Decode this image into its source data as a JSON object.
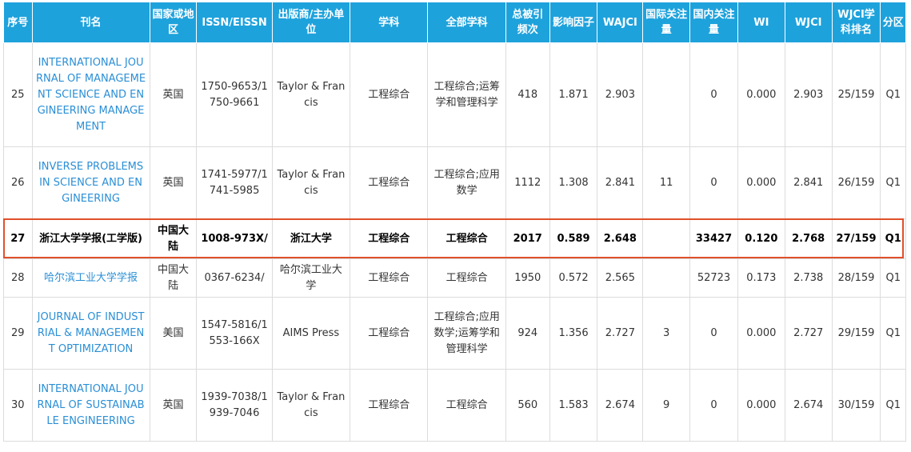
{
  "headers": [
    "序号",
    "刊名",
    "国家或地区",
    "ISSN/EISSN",
    "出版商/主办单位",
    "学科",
    "全部学科",
    "总被引频次",
    "影响因子",
    "WAJCI",
    "国际关注量",
    "国内关注量",
    "WI",
    "WJCI",
    "WJCI学科排名",
    "分区"
  ],
  "rows": [
    {
      "no": "25",
      "name": "INTERNATIONAL JOURNAL OF MANAGEMENT SCIENCE AND ENGINEERING MANAGEMENT",
      "country": "英国",
      "issn": "1750-9653/1750-9661",
      "publisher": "Taylor & Francis",
      "subject": "工程综合",
      "all_subjects": "工程综合;运筹学和管理科学",
      "citations": "418",
      "impact_factor": "1.871",
      "wajci": "2.903",
      "intl_attention": "",
      "domestic_attention": "0",
      "wi": "0.000",
      "wjci": "2.903",
      "rank": "25/159",
      "zone": "Q1"
    },
    {
      "no": "26",
      "name": "INVERSE PROBLEMS IN SCIENCE AND ENGINEERING",
      "country": "英国",
      "issn": "1741-5977/1741-5985",
      "publisher": "Taylor & Francis",
      "subject": "工程综合",
      "all_subjects": "工程综合;应用数学",
      "citations": "1112",
      "impact_factor": "1.308",
      "wajci": "2.841",
      "intl_attention": "11",
      "domestic_attention": "0",
      "wi": "0.000",
      "wjci": "2.841",
      "rank": "26/159",
      "zone": "Q1"
    },
    {
      "no": "27",
      "name": "浙江大学学报(工学版)",
      "country": "中国大陆",
      "issn": "1008-973X/",
      "publisher": "浙江大学",
      "subject": "工程综合",
      "all_subjects": "工程综合",
      "citations": "2017",
      "impact_factor": "0.589",
      "wajci": "2.648",
      "intl_attention": "",
      "domestic_attention": "33427",
      "wi": "0.120",
      "wjci": "2.768",
      "rank": "27/159",
      "zone": "Q1"
    },
    {
      "no": "28",
      "name": "哈尔滨工业大学学报",
      "country": "中国大陆",
      "issn": "0367-6234/",
      "publisher": "哈尔滨工业大学",
      "subject": "工程综合",
      "all_subjects": "工程综合",
      "citations": "1950",
      "impact_factor": "0.572",
      "wajci": "2.565",
      "intl_attention": "",
      "domestic_attention": "52723",
      "wi": "0.173",
      "wjci": "2.738",
      "rank": "28/159",
      "zone": "Q1"
    },
    {
      "no": "29",
      "name": "JOURNAL OF INDUSTRIAL & MANAGEMENT OPTIMIZATION",
      "country": "美国",
      "issn": "1547-5816/1553-166X",
      "publisher": "AIMS Press",
      "subject": "工程综合",
      "all_subjects": "工程综合;应用数学;运筹学和管理科学",
      "citations": "924",
      "impact_factor": "1.356",
      "wajci": "2.727",
      "intl_attention": "3",
      "domestic_attention": "0",
      "wi": "0.000",
      "wjci": "2.727",
      "rank": "29/159",
      "zone": "Q1"
    },
    {
      "no": "30",
      "name": "INTERNATIONAL JOURNAL OF SUSTAINABLE ENGINEERING",
      "country": "英国",
      "issn": "1939-7038/1939-7046",
      "publisher": "Taylor & Francis",
      "subject": "工程综合",
      "all_subjects": "工程综合",
      "citations": "560",
      "impact_factor": "1.583",
      "wajci": "2.674",
      "intl_attention": "9",
      "domestic_attention": "0",
      "wi": "0.000",
      "wjci": "2.674",
      "rank": "30/159",
      "zone": "Q1"
    }
  ],
  "highlighted_row": "27",
  "colors": {
    "header_bg": "#1ea2dc",
    "link": "#2b8fd6",
    "highlight_border": "#e0502a"
  }
}
